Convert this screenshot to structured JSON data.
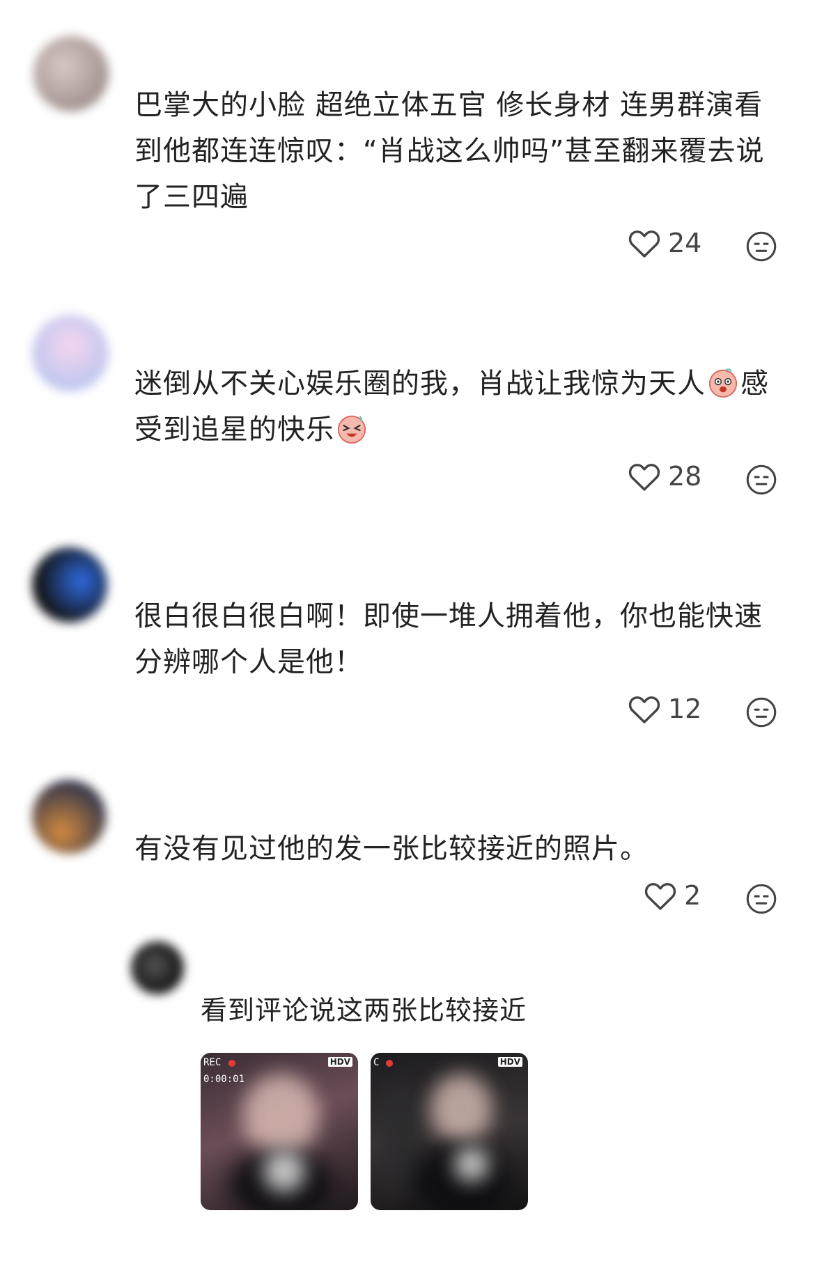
{
  "comments": [
    {
      "text_lines": [
        "巴掌大的小脸 超绝立体五官 修长身材 连男群演看",
        "到他都连连惊叹：“肖战这么帅吗”甚至翻来覆去说",
        "了三四遍"
      ],
      "likes": "24",
      "avatar_color": "#b9a9a6"
    },
    {
      "text_lines": [
        "迷倒从不关心娱乐圈的我，肖战让我惊为天人",
        "受到追星的快乐"
      ],
      "text_line1_tail": "感",
      "likes": "28",
      "avatar_color": "#c8b4e4"
    },
    {
      "text_lines": [
        "很白很白很白啊！即使一堆人拥着他，你也能快速",
        "分辨哪个人是他！"
      ],
      "likes": "12",
      "avatar_color": "#2f5fd0"
    },
    {
      "text_lines": [
        "有没有见过他的发一张比较接近的照片。"
      ],
      "likes": "2",
      "avatar_color": "#c98a4a"
    }
  ],
  "reply": {
    "text": "看到评论说这两张比较接近",
    "photos": [
      {
        "rec_label": "REC",
        "time_label": "0:00:01",
        "hdv_label": "HDV"
      },
      {
        "rec_label": "C",
        "hdv_label": "HDV"
      }
    ]
  },
  "icons": {
    "like": "heart-outline-icon",
    "dislike": "neutral-face-icon",
    "emoji_shocked": "shocked-pig-emoji-icon",
    "emoji_laugh": "laughing-pig-emoji-icon"
  }
}
